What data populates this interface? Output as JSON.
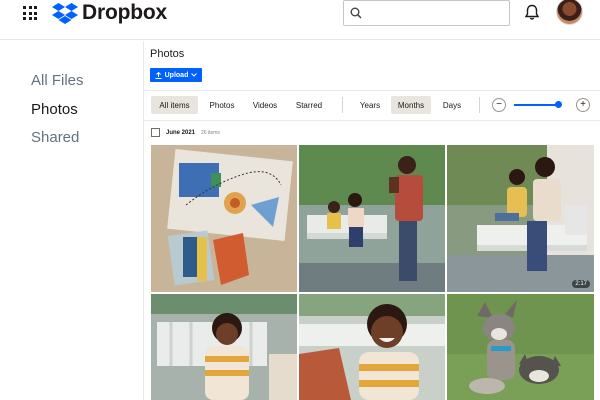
{
  "header": {
    "brand": "Dropbox",
    "search_placeholder": "",
    "search_value": ""
  },
  "sidebar": {
    "items": [
      {
        "label": "All Files",
        "active": false
      },
      {
        "label": "Photos",
        "active": true
      },
      {
        "label": "Shared",
        "active": false
      }
    ]
  },
  "main": {
    "title": "Photos",
    "upload_label": "Upload",
    "filters": [
      "All items",
      "Photos",
      "Videos",
      "Starred"
    ],
    "selected_filter": "All items",
    "granularity": [
      "Years",
      "Months",
      "Days"
    ],
    "selected_granularity": "Months",
    "zoom_level": 0.85,
    "section_date": "June 2021",
    "section_count": "26 items",
    "photos": [
      {
        "kind": "art collage on rug"
      },
      {
        "kind": "family on porch swing, father taking photo"
      },
      {
        "kind": "mother and son on porch swing",
        "duration": "2:17"
      },
      {
        "kind": "boy on white bench"
      },
      {
        "kind": "boy laughing"
      },
      {
        "kind": "two dogs on grass"
      }
    ]
  },
  "colors": {
    "accent": "#0061fe",
    "text": "#1e1919",
    "muted": "#637282",
    "chip_selected": "#e8e4de"
  },
  "icons": [
    "apps-grid-icon",
    "dropbox-logo-icon",
    "search-icon",
    "bell-icon",
    "upload-icon",
    "chevron-down-icon",
    "zoom-out-icon",
    "zoom-in-icon"
  ]
}
